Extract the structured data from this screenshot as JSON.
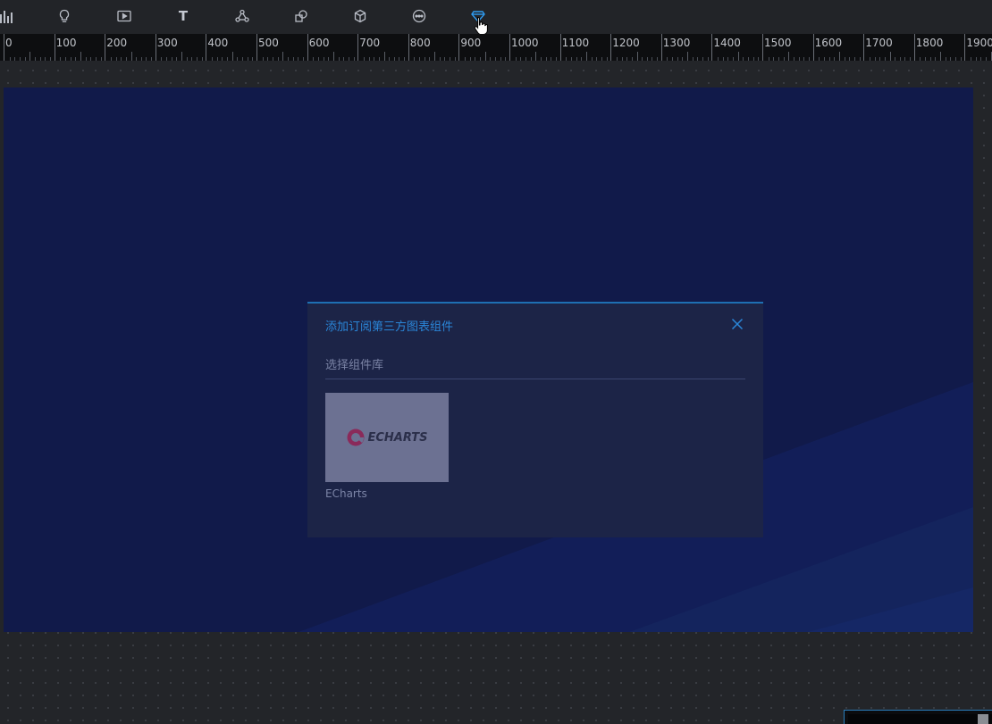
{
  "toolbar": {
    "tools": [
      {
        "icon": "bar-chart-icon"
      },
      {
        "icon": "lightbulb-icon"
      },
      {
        "icon": "play-media-icon"
      },
      {
        "icon": "text-icon",
        "glyph": "T"
      },
      {
        "icon": "relation-graph-icon"
      },
      {
        "icon": "shapes-icon"
      },
      {
        "icon": "cube-3d-icon"
      },
      {
        "icon": "more-icon"
      },
      {
        "icon": "diamond-icon",
        "active": true
      }
    ],
    "active_color": "#2f9bf0"
  },
  "ruler": {
    "labels": [
      "0",
      "100",
      "200",
      "300",
      "400",
      "500",
      "600",
      "700",
      "800",
      "900",
      "1000",
      "1100",
      "1200",
      "1300",
      "1400",
      "1500",
      "1600",
      "1700",
      "1800",
      "1900"
    ]
  },
  "modal": {
    "title": "添加订阅第三方图表组件",
    "section_label": "选择组件库",
    "libraries": [
      {
        "name": "ECharts",
        "logo_text": "ECHARTS",
        "logo_color": "#8a2a5a"
      }
    ],
    "accent_color": "#2a86d8"
  },
  "canvas": {
    "background": "#111a4a"
  }
}
